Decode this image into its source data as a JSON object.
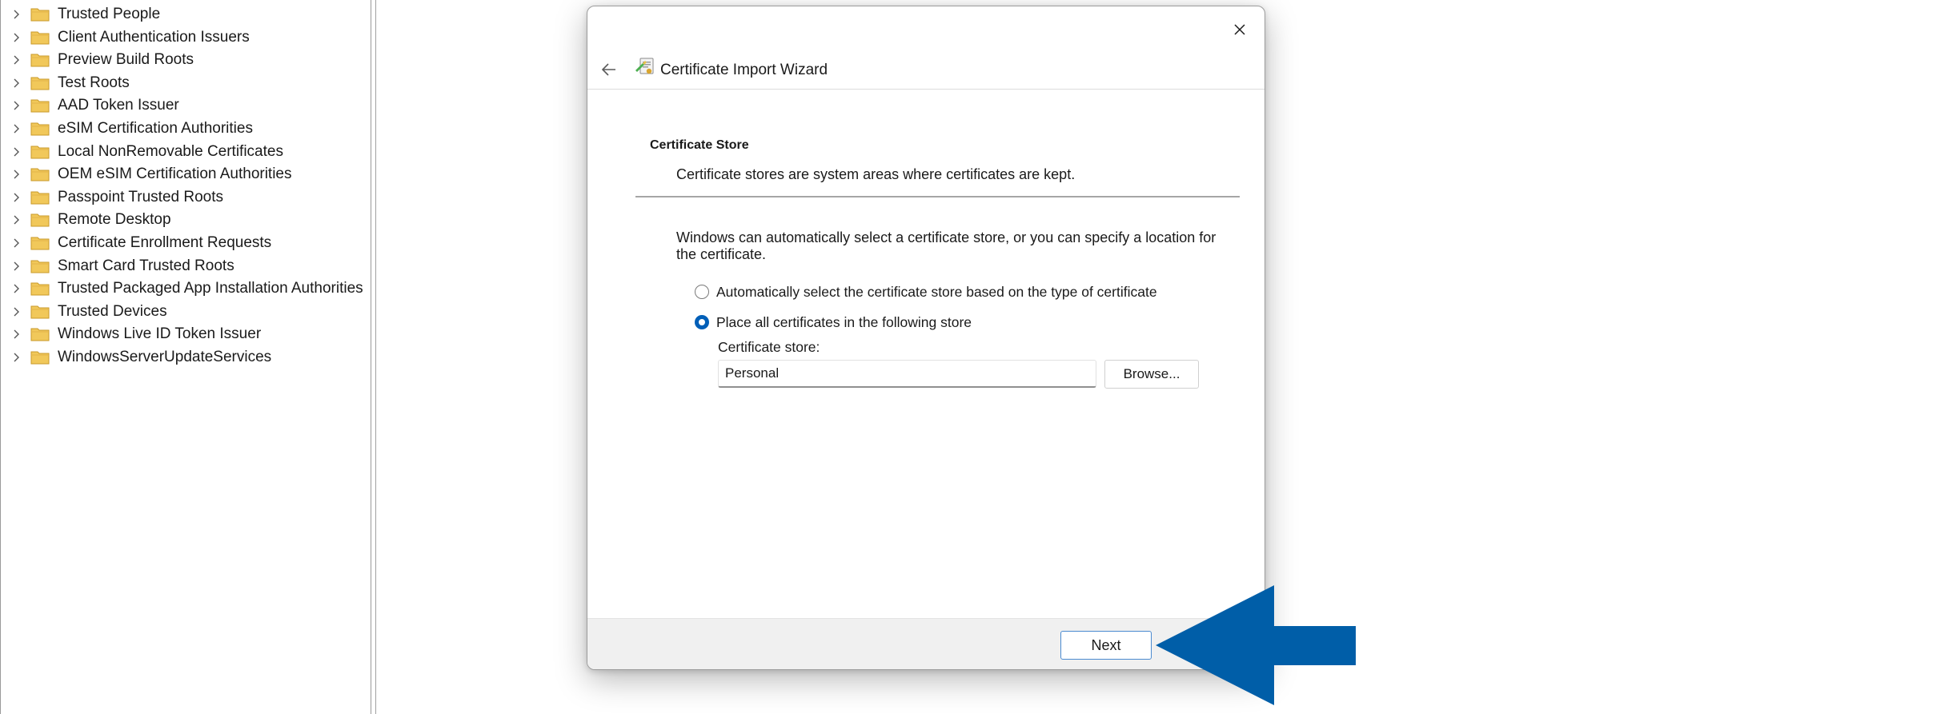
{
  "tree": {
    "items": [
      {
        "label": "Trusted People"
      },
      {
        "label": "Client Authentication Issuers"
      },
      {
        "label": "Preview Build Roots"
      },
      {
        "label": "Test Roots"
      },
      {
        "label": "AAD Token Issuer"
      },
      {
        "label": "eSIM Certification Authorities"
      },
      {
        "label": "Local NonRemovable Certificates"
      },
      {
        "label": "OEM eSIM Certification Authorities"
      },
      {
        "label": "Passpoint Trusted Roots"
      },
      {
        "label": "Remote Desktop"
      },
      {
        "label": "Certificate Enrollment Requests"
      },
      {
        "label": "Smart Card Trusted Roots"
      },
      {
        "label": "Trusted Packaged App Installation Authorities"
      },
      {
        "label": "Trusted Devices"
      },
      {
        "label": "Windows Live ID Token Issuer"
      },
      {
        "label": "WindowsServerUpdateServices"
      }
    ],
    "folder_icon": "folder-icon",
    "expander_icon": "chevron-right-icon",
    "folder_color": "#f1c85a"
  },
  "dialog": {
    "title": "Certificate Import Wizard",
    "back_icon": "arrow-left-icon",
    "close_icon": "close-icon",
    "section_title": "Certificate Store",
    "section_description": "Certificate stores are system areas where certificates are kept.",
    "intro": "Windows can automatically select a certificate store, or you can specify a location for the certificate.",
    "options": {
      "auto": {
        "label": "Automatically select the certificate store based on the type of certificate",
        "selected": false
      },
      "manual": {
        "label": "Place all certificates in the following store",
        "selected": true
      }
    },
    "store_label": "Certificate store:",
    "store_value": "Personal",
    "browse_label": "Browse...",
    "next_label": "Next"
  },
  "colors": {
    "accent": "#005fb8",
    "callout_arrow": "#005ea8"
  }
}
